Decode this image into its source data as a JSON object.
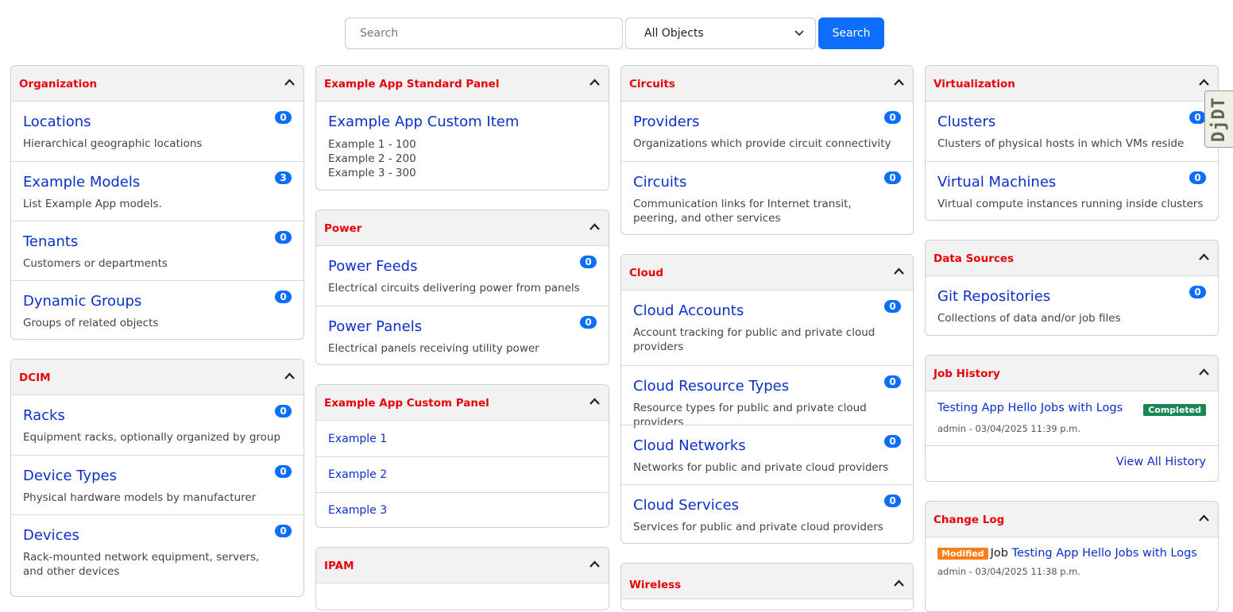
{
  "search": {
    "placeholder": "Search",
    "object_select": "All Objects",
    "button_label": "Search"
  },
  "colors": {
    "accent": "#0d6efd",
    "panel_title": "#e8000b",
    "link": "#0b2fcc",
    "completed": "#198754",
    "modified": "#fd7e14"
  },
  "organization": {
    "title": "Organization",
    "items": [
      {
        "title": "Locations",
        "desc": "Hierarchical geographic locations",
        "count": "0"
      },
      {
        "title": "Example Models",
        "desc": "List Example App models.",
        "count": "3"
      },
      {
        "title": "Tenants",
        "desc": "Customers or departments",
        "count": "0"
      },
      {
        "title": "Dynamic Groups",
        "desc": "Groups of related objects",
        "count": "0"
      }
    ]
  },
  "dcim": {
    "title": "DCIM",
    "items": [
      {
        "title": "Racks",
        "desc": "Equipment racks, optionally organized by group",
        "count": "0"
      },
      {
        "title": "Device Types",
        "desc": "Physical hardware models by manufacturer",
        "count": "0"
      },
      {
        "title": "Devices",
        "desc": "Rack-mounted network equipment, servers, and other devices",
        "count": "0"
      }
    ]
  },
  "example_standard": {
    "title": "Example App Standard Panel",
    "item_title": "Example App Custom Item",
    "lines": [
      "Example 1 - 100",
      "Example 2 - 200",
      "Example 3 - 300"
    ]
  },
  "power": {
    "title": "Power",
    "items": [
      {
        "title": "Power Feeds",
        "desc": "Electrical circuits delivering power from panels",
        "count": "0"
      },
      {
        "title": "Power Panels",
        "desc": "Electrical panels receiving utility power",
        "count": "0"
      }
    ]
  },
  "example_custom": {
    "title": "Example App Custom Panel",
    "links": [
      "Example 1",
      "Example 2",
      "Example 3"
    ]
  },
  "ipam": {
    "title": "IPAM"
  },
  "circuits": {
    "title": "Circuits",
    "items": [
      {
        "title": "Providers",
        "desc": "Organizations which provide circuit connectivity",
        "count": "0"
      },
      {
        "title": "Circuits",
        "desc": "Communication links for Internet transit, peering, and other services",
        "count": "0"
      }
    ]
  },
  "cloud": {
    "title": "Cloud",
    "items": [
      {
        "title": "Cloud Accounts",
        "desc": "Account tracking for public and private cloud providers",
        "count": "0"
      },
      {
        "title": "Cloud Resource Types",
        "desc": "Resource types for public and private cloud providers",
        "count": "0"
      },
      {
        "title": "Cloud Networks",
        "desc": "Networks for public and private cloud providers",
        "count": "0"
      },
      {
        "title": "Cloud Services",
        "desc": "Services for public and private cloud providers",
        "count": "0"
      }
    ]
  },
  "wireless": {
    "title": "Wireless"
  },
  "virtualization": {
    "title": "Virtualization",
    "items": [
      {
        "title": "Clusters",
        "desc": "Clusters of physical hosts in which VMs reside",
        "count": "0"
      },
      {
        "title": "Virtual Machines",
        "desc": "Virtual compute instances running inside clusters",
        "count": "0"
      }
    ]
  },
  "data_sources": {
    "title": "Data Sources",
    "items": [
      {
        "title": "Git Repositories",
        "desc": "Collections of data and/or job files",
        "count": "0"
      }
    ]
  },
  "job_history": {
    "title": "Job History",
    "entry": {
      "name": "Testing App Hello Jobs with Logs",
      "status": "Completed",
      "meta": "admin - 03/04/2025 11:39 p.m."
    },
    "view_all": "View All History"
  },
  "change_log": {
    "title": "Change Log",
    "entry": {
      "action": "Modified",
      "type": "Job",
      "name": "Testing App Hello Jobs with Logs",
      "meta": "admin - 03/04/2025 11:38 p.m."
    }
  },
  "debug_toolbar": {
    "label": "DjDT"
  }
}
